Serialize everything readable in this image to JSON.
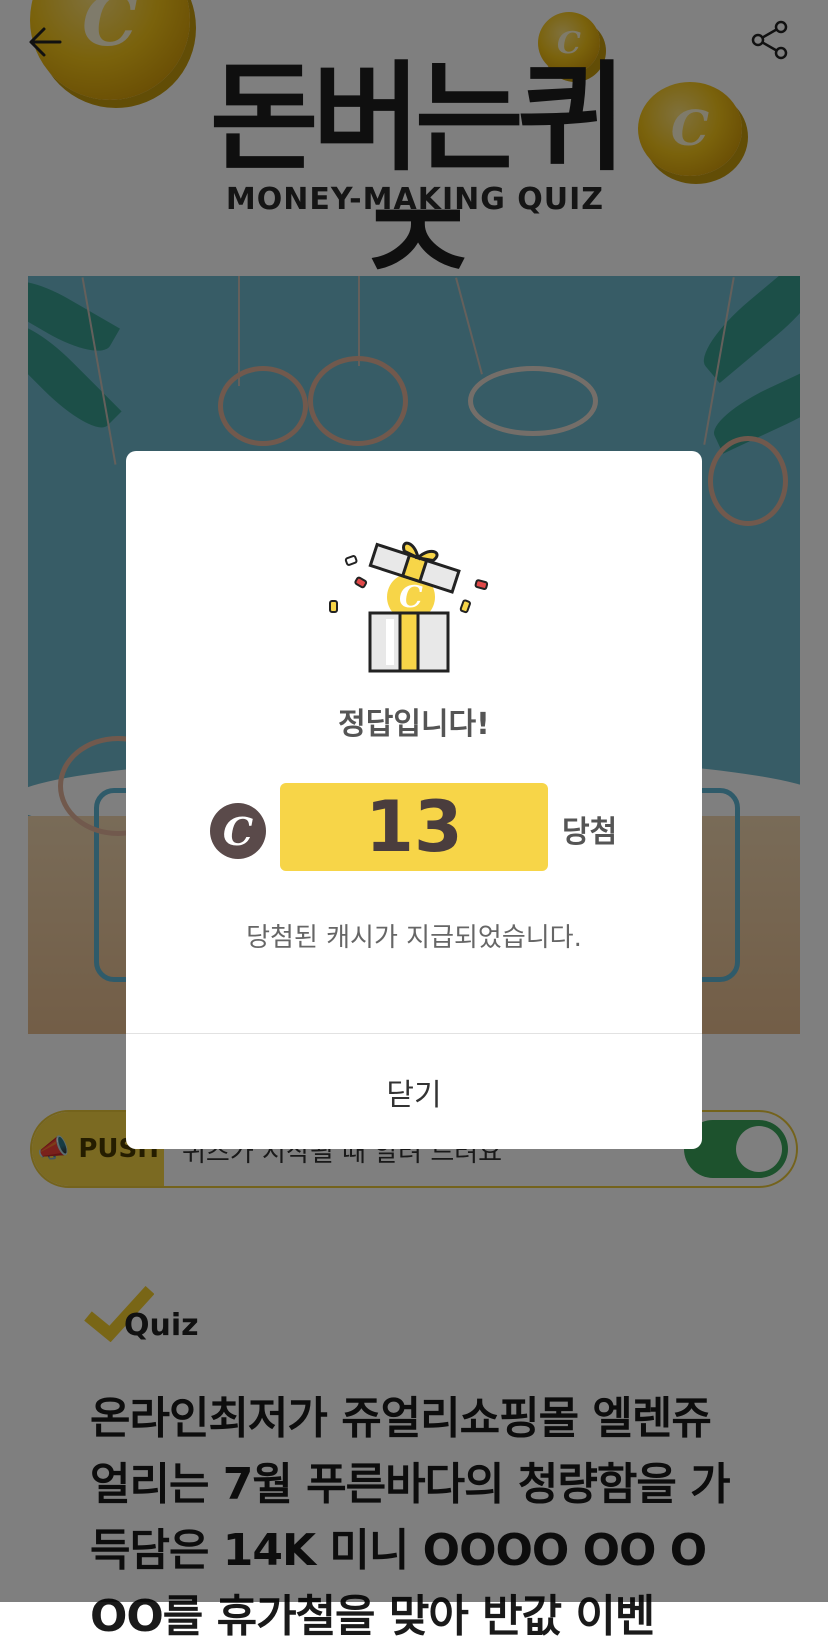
{
  "header": {
    "logo_title": "돈버는퀴즈",
    "logo_subtitle": "MONEY-MAKING QUIZ",
    "coin_glyph": "C"
  },
  "push": {
    "badge": "📣 PUSH",
    "text": "퀴즈가 시작될 때 알려 드려요",
    "enabled": true
  },
  "quiz": {
    "label": "Quiz",
    "question": "온라인최저가 쥬얼리쇼핑몰 엘렌쥬얼리는 7월 푸른바다의 청량함을 가득담은 14K 미니 OOOO OO O OO를 휴가철을 맞아 반값 이벤"
  },
  "modal": {
    "title": "정답입니다!",
    "cash_icon": "C",
    "amount": "13",
    "win_label": "당첨",
    "message": "당첨된 캐시가 지급되었습니다.",
    "close_label": "닫기"
  },
  "colors": {
    "accent_yellow": "#f7d548",
    "toggle_green": "#3aa45a",
    "cash_brown": "#5a4a4a"
  }
}
